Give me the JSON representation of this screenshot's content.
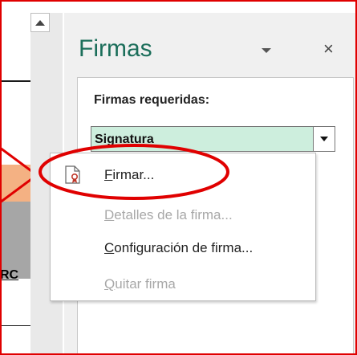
{
  "sheet": {
    "cell_text": "RC"
  },
  "pane": {
    "title": "Firmas",
    "close_glyph": "×"
  },
  "required": {
    "label": "Firmas requeridas:",
    "selected": "Signatura"
  },
  "menu": {
    "sign_underline": "F",
    "sign_rest": "irmar...",
    "details_underline": "D",
    "details_rest": "etalles de la firma...",
    "setup_underline": "C",
    "setup_rest": "onfiguración de firma...",
    "remove_underline": "Q",
    "remove_rest": "uitar firma"
  },
  "colors": {
    "highlight": "#e00000",
    "accent": "#1b6e5a",
    "combo_fill": "#cdeedd",
    "orange_cell": "#f4b183"
  },
  "icons": [
    "scroll-up-icon",
    "dropdown-arrow-icon",
    "close-icon",
    "certificate-icon"
  ]
}
